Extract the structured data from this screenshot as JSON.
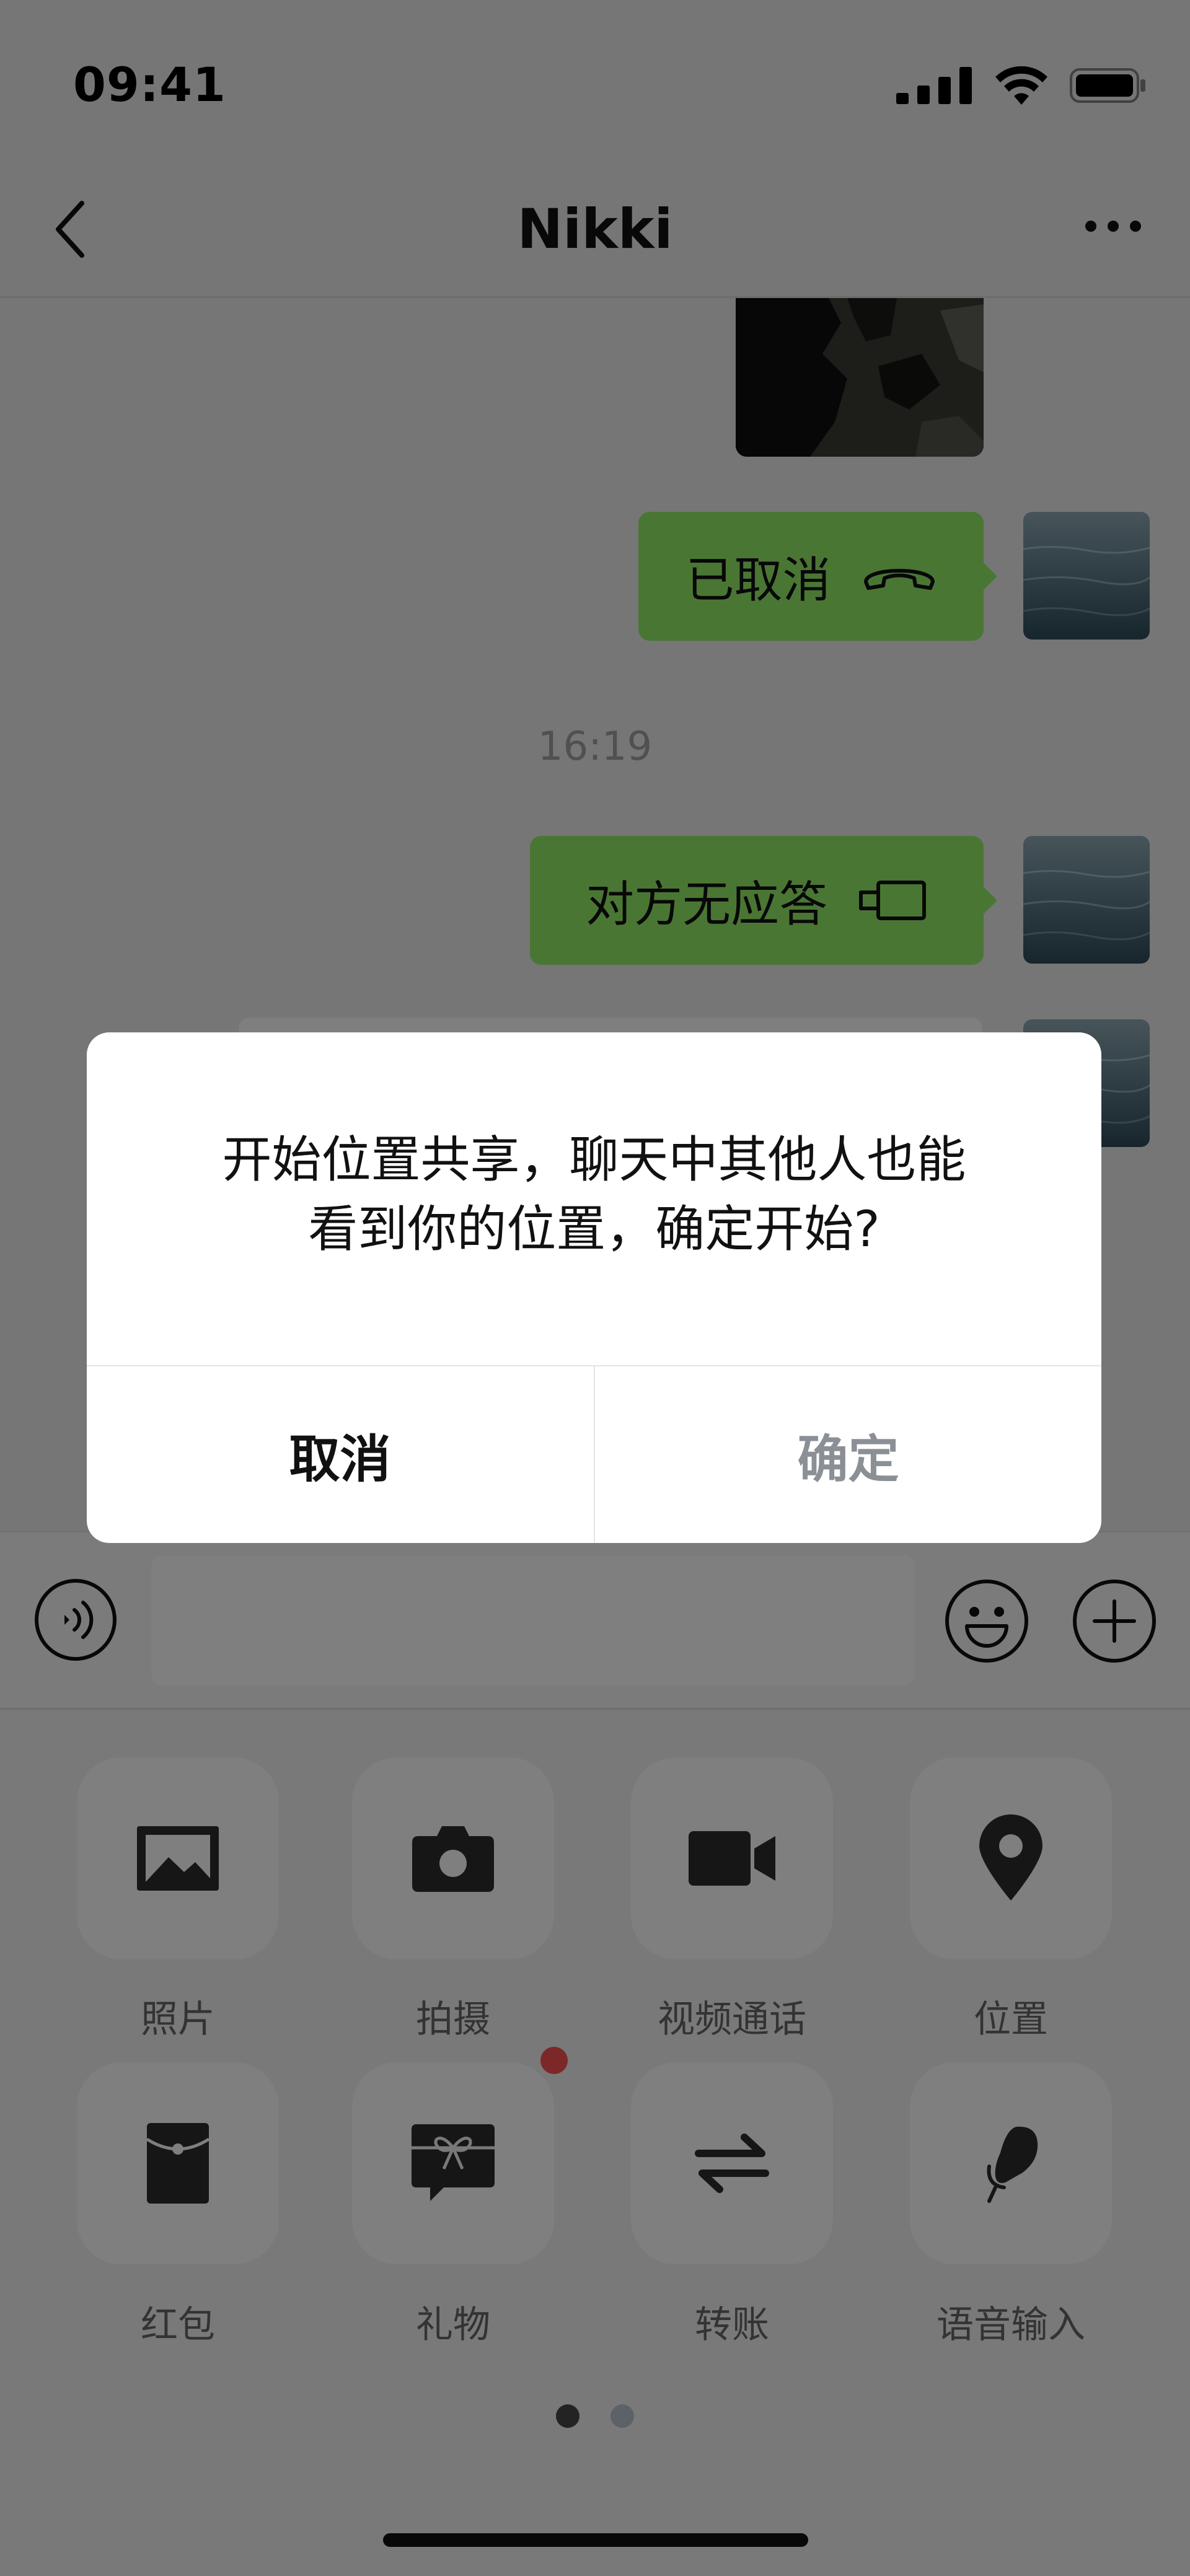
{
  "status_bar": {
    "time": "09:41"
  },
  "nav": {
    "title": "Nikki"
  },
  "messages": {
    "canceled_call": "已取消",
    "timestamp": "16:19",
    "no_answer_video": "对方无应答"
  },
  "dialog": {
    "message_line1": "开始位置共享，聊天中其他人也能",
    "message_line2": "看到你的位置，确定开始?",
    "cancel_label": "取消",
    "confirm_label": "确定"
  },
  "panel": {
    "items": [
      {
        "label": "照片",
        "icon": "photo-icon"
      },
      {
        "label": "拍摄",
        "icon": "camera-icon"
      },
      {
        "label": "视频通话",
        "icon": "video-call-icon"
      },
      {
        "label": "位置",
        "icon": "location-pin-icon"
      },
      {
        "label": "红包",
        "icon": "red-packet-icon"
      },
      {
        "label": "礼物",
        "icon": "gift-icon"
      },
      {
        "label": "转账",
        "icon": "transfer-icon"
      },
      {
        "label": "语音输入",
        "icon": "microphone-icon"
      }
    ],
    "page_count": 2,
    "current_page": 1
  },
  "colors": {
    "bubble_green": "#95ec69",
    "badge_red": "#fa5151",
    "overlay": "rgba(0,0,0,0.5)"
  }
}
